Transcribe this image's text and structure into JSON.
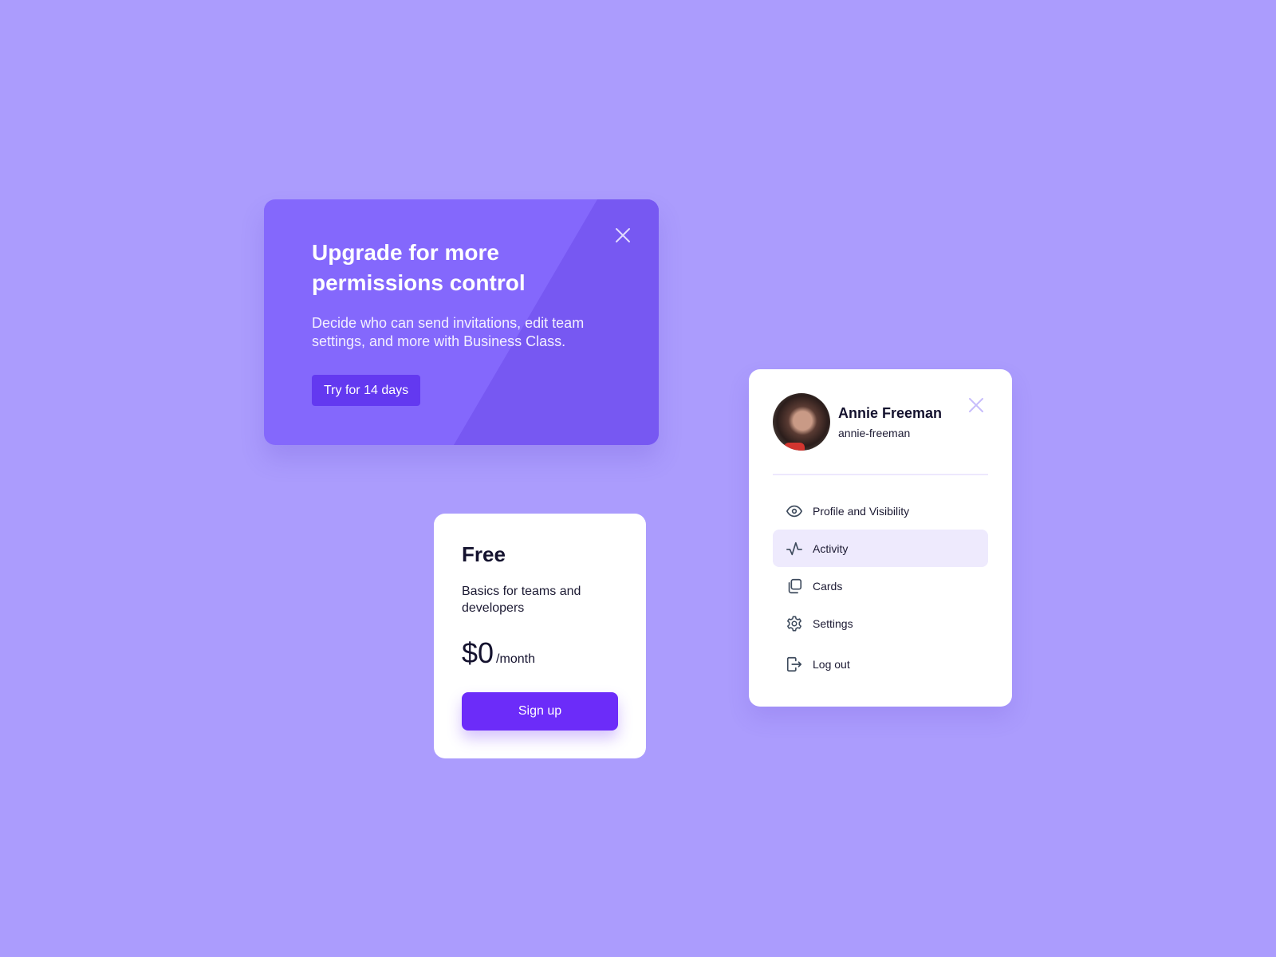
{
  "colors": {
    "background": "#ab9cfd",
    "banner": "#8468fc",
    "banner_accent": "#6339f0",
    "primary": "#6c2cf9",
    "active_menu_bg": "#eeeafd"
  },
  "upgrade_banner": {
    "title": "Upgrade for more permissions control",
    "description": "Decide who can send invitations, edit team settings, and more with Business Class.",
    "cta_label": "Try for 14 days",
    "close_icon": "close-icon"
  },
  "pricing_card": {
    "plan_name": "Free",
    "description": "Basics for teams and developers",
    "price": "$0",
    "period": "/month",
    "cta_label": "Sign up"
  },
  "profile_menu": {
    "name": "Annie Freeman",
    "handle": "annie-freeman",
    "close_icon": "close-icon",
    "items": [
      {
        "label": "Profile and Visibility",
        "icon": "eye-icon",
        "active": false
      },
      {
        "label": "Activity",
        "icon": "activity-icon",
        "active": true
      },
      {
        "label": "Cards",
        "icon": "cards-icon",
        "active": false
      },
      {
        "label": "Settings",
        "icon": "gear-icon",
        "active": false
      },
      {
        "label": "Log out",
        "icon": "logout-icon",
        "active": false
      }
    ]
  }
}
